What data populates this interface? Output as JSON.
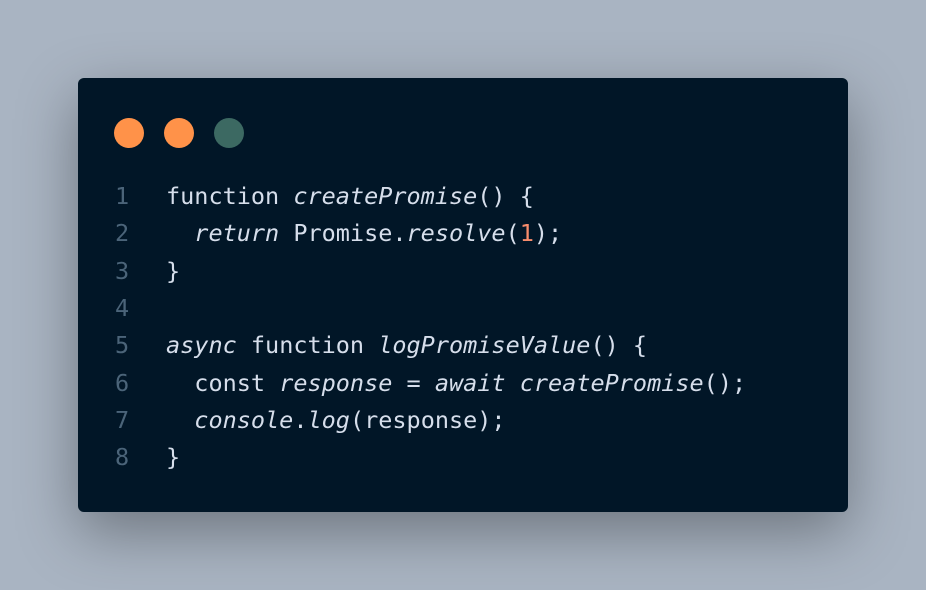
{
  "window": {
    "dots": [
      {
        "name": "close-dot",
        "color": "#ff9249"
      },
      {
        "name": "minimize-dot",
        "color": "#ff9249"
      },
      {
        "name": "maximize-dot",
        "color": "#3c6962"
      }
    ]
  },
  "theme": {
    "background": "#011627",
    "text": "#d6deeb",
    "line_number": "#4b6479",
    "number": "#f78c6c"
  },
  "code": {
    "lines": [
      {
        "number": "1",
        "tokens": [
          {
            "text": "function "
          },
          {
            "text": "createPromise",
            "italic": true
          },
          {
            "text": "() {"
          }
        ]
      },
      {
        "number": "2",
        "tokens": [
          {
            "text": "  "
          },
          {
            "text": "return",
            "italic": true
          },
          {
            "text": " Promise."
          },
          {
            "text": "resolve",
            "italic": true
          },
          {
            "text": "("
          },
          {
            "text": "1",
            "color": "#f78c6c"
          },
          {
            "text": ");"
          }
        ]
      },
      {
        "number": "3",
        "tokens": [
          {
            "text": "}"
          }
        ]
      },
      {
        "number": "4",
        "tokens": []
      },
      {
        "number": "5",
        "tokens": [
          {
            "text": "async",
            "italic": true
          },
          {
            "text": " function "
          },
          {
            "text": "logPromiseValue",
            "italic": true
          },
          {
            "text": "() {"
          }
        ]
      },
      {
        "number": "6",
        "tokens": [
          {
            "text": "  const "
          },
          {
            "text": "response",
            "italic": true
          },
          {
            "text": " = "
          },
          {
            "text": "await",
            "italic": true
          },
          {
            "text": " "
          },
          {
            "text": "createPromise",
            "italic": true
          },
          {
            "text": "();"
          }
        ]
      },
      {
        "number": "7",
        "tokens": [
          {
            "text": "  "
          },
          {
            "text": "console",
            "italic": true
          },
          {
            "text": "."
          },
          {
            "text": "log",
            "italic": true
          },
          {
            "text": "(response);"
          }
        ]
      },
      {
        "number": "8",
        "tokens": [
          {
            "text": "}"
          }
        ]
      }
    ]
  }
}
